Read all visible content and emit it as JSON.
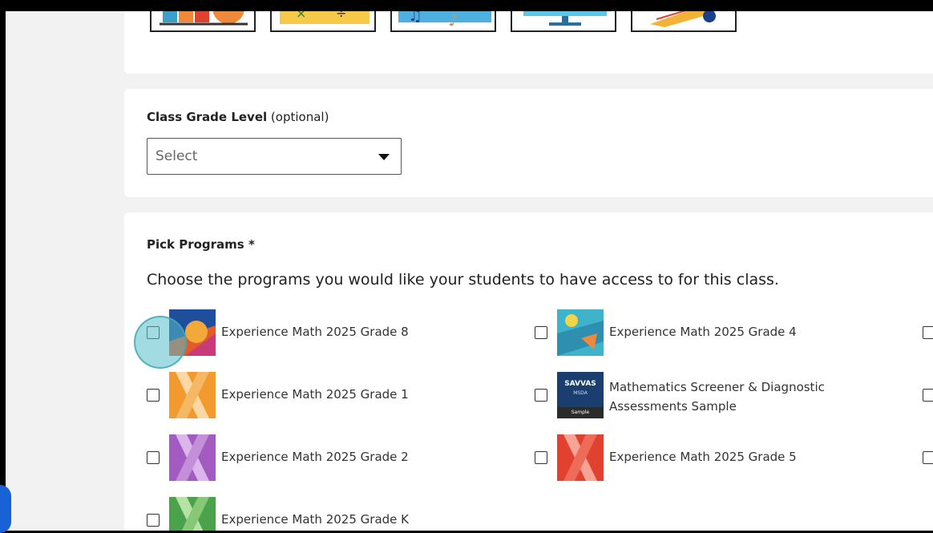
{
  "subject_tiles": [
    {
      "icon": "chart-icon"
    },
    {
      "icon": "math-symbols-icon"
    },
    {
      "icon": "music-notes-icon"
    },
    {
      "icon": "computer-icon"
    },
    {
      "icon": "science-icon"
    }
  ],
  "grade_level": {
    "label": "Class Grade Level",
    "optional": "(optional)",
    "select_value": "Select"
  },
  "programs": {
    "heading": "Pick Programs *",
    "description": "Choose the programs you would like your students to have access to for this class.",
    "items": [
      {
        "label": "Experience Math 2025 Grade 8",
        "checked": false
      },
      {
        "label": "Experience Math 2025 Grade 4",
        "checked": false
      },
      {
        "label": "Experience Math 2025 Grade 1",
        "checked": false
      },
      {
        "label": "Mathematics Screener & Diagnostic Assessments Sample",
        "checked": false
      },
      {
        "label": "Experience Math 2025 Grade 2",
        "checked": false
      },
      {
        "label": "Experience Math 2025 Grade 5",
        "checked": false
      },
      {
        "label": "Experience Math 2025 Grade K",
        "checked": false
      }
    ],
    "msda_cover": {
      "brand": "SAVVAS",
      "sub": "MSDA",
      "tag": "Sample"
    }
  },
  "colors": {
    "focus": "#55bec8",
    "grade1": "#f39a2e",
    "grade2": "#a25bc0",
    "grade5": "#e0422f",
    "gradeK": "#4aa34a"
  }
}
